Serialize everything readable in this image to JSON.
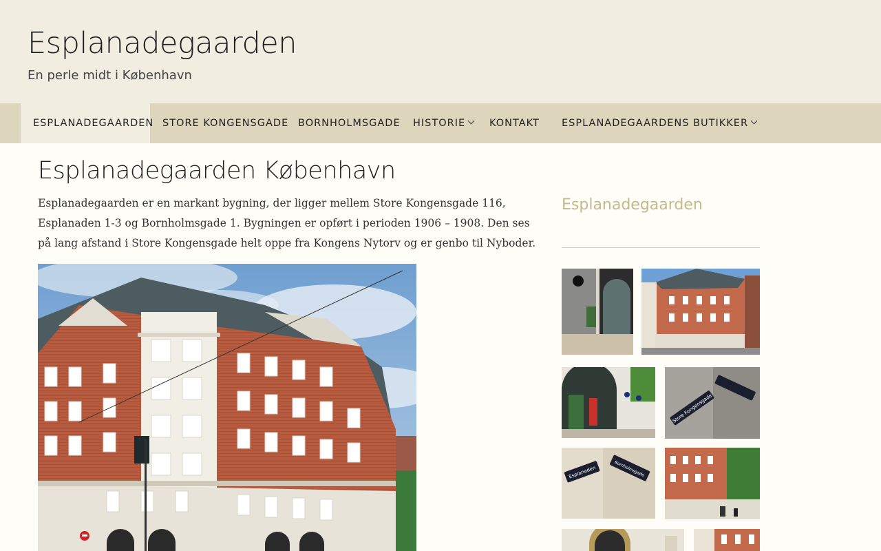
{
  "site": {
    "title": "Esplanadegaarden",
    "tagline": "En perle midt i København"
  },
  "nav": {
    "items": [
      {
        "label": "ESPLANADEGAARDEN"
      },
      {
        "label": "STORE KONGENSGADE"
      },
      {
        "label": "BORNHOLMSGADE"
      },
      {
        "label": "HISTORIE"
      },
      {
        "label": "KONTAKT"
      },
      {
        "label": "ESPLANADEGAARDENS BUTIKKER"
      }
    ]
  },
  "main": {
    "title": "Esplanadegaarden København",
    "intro": "Esplanadegaarden er en markant bygning, der ligger mellem Store Kongensgade 116, Esplanaden 1-3 og Bornholmsgade 1. Bygningen er opført i perioden 1906 – 1908. Den ses på lang afstand i Store Kongensgade helt oppe fra Kongens Nytorv og er genbo til Nyboder."
  },
  "sidebar": {
    "title": "Esplanadegaarden",
    "sign_texts": [
      "Esplanaden",
      "Bornholmsgade",
      "Store Kongensgade"
    ]
  },
  "colors": {
    "header_bg": "#f1ede0",
    "nav_bg": "#ddd6bd",
    "accent": "#c5b98a",
    "brick": "#b85a3e"
  }
}
